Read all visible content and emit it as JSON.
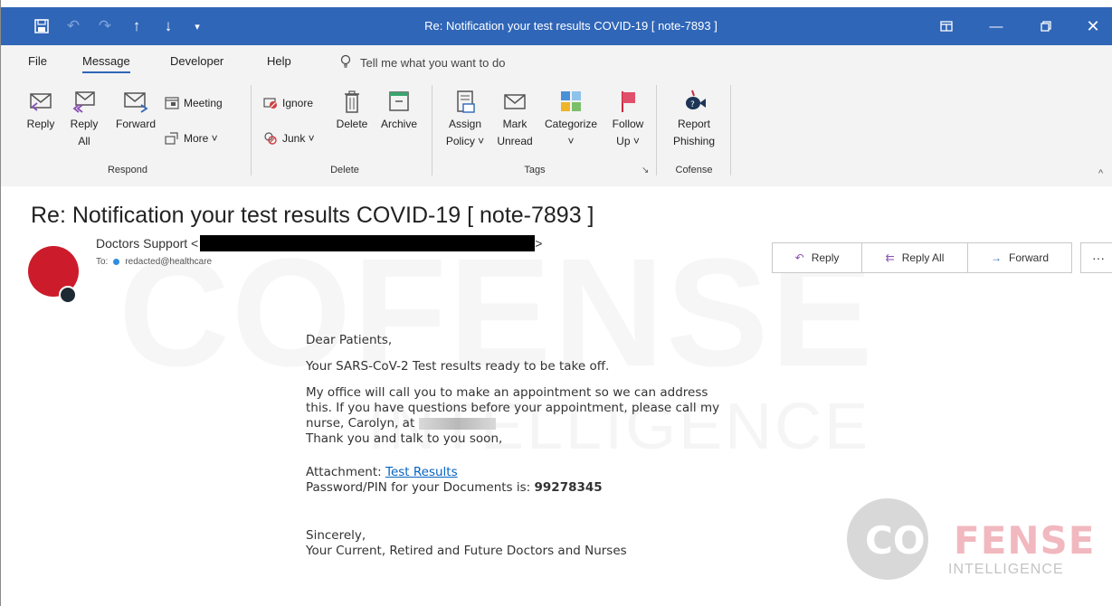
{
  "window": {
    "title": "Re: Notification your test results COVID-19 [ note-7893 ]",
    "accent_color": "#2f66b8"
  },
  "quick_access": [
    "save-icon",
    "undo-icon",
    "redo-icon",
    "up-arrow-icon",
    "down-arrow-icon",
    "customize-icon"
  ],
  "window_controls": [
    "restore-window-icon",
    "minimize-icon",
    "maximize-icon",
    "close-icon"
  ],
  "menu": {
    "tabs": [
      "File",
      "Message",
      "Developer",
      "Help"
    ],
    "active_tab": "Message",
    "tell_me": "Tell me what you want to do"
  },
  "ribbon": {
    "respond": {
      "label": "Respond",
      "reply": "Reply",
      "reply_all": "Reply\nAll",
      "forward": "Forward",
      "meeting": "Meeting",
      "more": "More ˅"
    },
    "delete": {
      "label": "Delete",
      "ignore": "Ignore",
      "junk": "Junk ˅",
      "delete": "Delete",
      "archive": "Archive"
    },
    "tags": {
      "label": "Tags",
      "assign_policy": "Assign\nPolicy ˅",
      "mark_unread": "Mark\nUnread",
      "categorize": "Categorize\n˅",
      "follow_up": "Follow\nUp ˅"
    },
    "cofense": {
      "label": "Cofense",
      "report_phishing": "Report\nPhishing"
    }
  },
  "message": {
    "subject": "Re: Notification your test results COVID-19 [ note-7893 ]",
    "sender_name": "Doctors Support <",
    "sender_end": ">",
    "to_label": "To:",
    "to_address": "redacted@healthcare",
    "avatar_color": "#cc1c2c",
    "actions": {
      "reply": "Reply",
      "reply_all": "Reply All",
      "forward": "Forward",
      "more": "···"
    },
    "body": {
      "greeting": "Dear Patients,",
      "line1": "Your SARS-CoV-2 Test results ready to be take off.",
      "para2_a": "My office will call you to make an appointment so we can address",
      "para2_b": "this. If you have questions before your appointment, please call my",
      "para2_c": "nurse, Carolyn, at",
      "para2_d": "Thank you and talk to you soon,",
      "attachment_label": "Attachment:",
      "attachment_link": "Test Results",
      "pin_label": "Password/PIN for your Documents is:",
      "pin_value": "99278345",
      "closing": "Sincerely,",
      "signature": "Your Current, Retired and Future Doctors and Nurses"
    }
  },
  "watermark": {
    "logo_co": "CO",
    "logo_fense": "FENSE",
    "logo_intel": "INTELLIGENCE",
    "bg_large": "COFENSE",
    "bg_small": "INTELLIGENCE"
  }
}
